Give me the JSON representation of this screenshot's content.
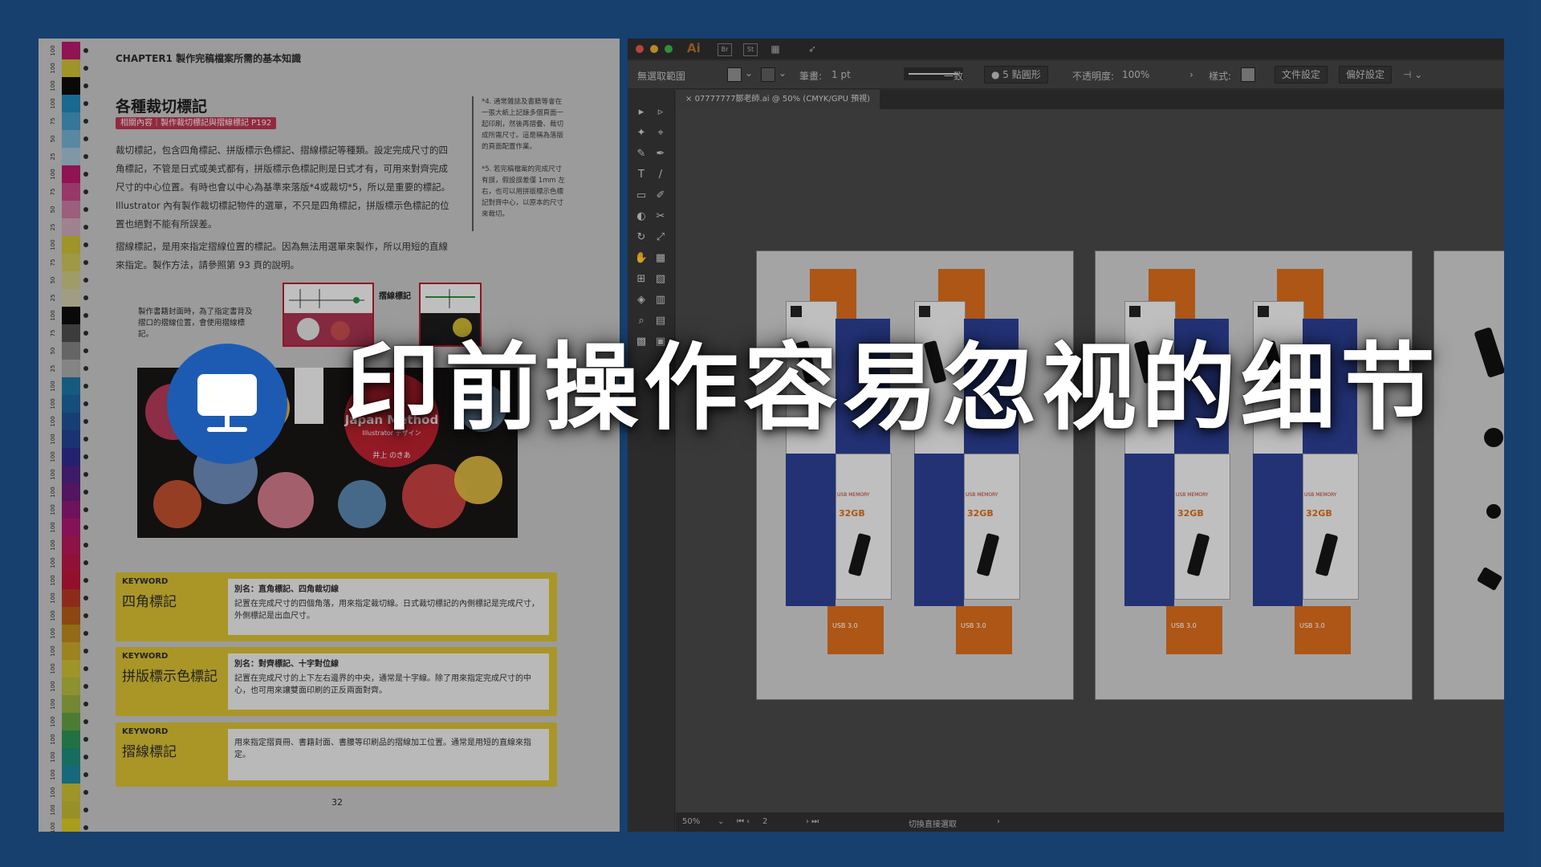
{
  "headline": "印前操作容易忽视的细节",
  "overlay_icon": "monitor-icon",
  "colors": {
    "background": "#1d4f87",
    "icon_circle": "#1d5bb3",
    "related_tag": "#b2334d",
    "keyword_box": "#cfb830",
    "crop_mark_box": "#b11a2c",
    "package_orange": "#d46a1c",
    "package_blue": "#2a3d8f"
  },
  "book": {
    "chapter": "CHAPTER1 製作完稿檔案所需的基本知識",
    "title": "各種裁切標記",
    "related": "相關內容｜製作裁切標記與摺線標記 P192",
    "para1": "裁切標記，包含四角標記、拼版標示色標記、摺線標記等種類。設定完成尺寸的四角標記，不管是日式或美式都有，拼版標示色標記則是日式才有，可用來對齊完成尺寸的中心位置。有時也會以中心為基準來落版*4或裁切*5，所以是重要的標記。Illustrator 內有製作裁切標記物件的選單，不只是四角標記，拼版標示色標記的位置也絕對不能有所誤差。",
    "para2": "摺線標記，是用來指定摺線位置的標記。因為無法用選單來製作，所以用短的直線來指定。製作方法，請參照第 93 頁的說明。",
    "note1": "*4. 通常雜誌及書籍等會在一張大紙上記錄多個頁面一起印刷，然後再摺疊、裁切成所需尺寸。這是稱為落版的頁面配置作業。",
    "note2": "*5. 若完稿檔案的完成尺寸有誤，假設誤差僅 1mm 左右，也可以用拼版標示色標記對齊中心，以原本的尺寸來裁切。",
    "caption": "製作書籍封面時，為了指定書背及摺口的摺線位置，會使用摺線標記。",
    "mark_label": "摺線標記",
    "cover_title": "Japan Method",
    "cover_sub": "Illustrator デザイン",
    "cover_author": "井上 のきあ",
    "keyword_label": "KEYWORD",
    "keywords": [
      {
        "term": "四角標記",
        "alias": "別名：直角標記、四角裁切線",
        "desc": "記置在完成尺寸的四個角落，用來指定裁切線。日式裁切標記的內側標記是完成尺寸，外側標記是出血尺寸。"
      },
      {
        "term": "拼版標示色標記",
        "alias": "別名：對齊標記、十字對位線",
        "desc": "記置在完成尺寸的上下左右邊界的中央，通常是十字線。除了用來指定完成尺寸的中心，也可用來讓雙面印刷的正反兩面對齊。"
      },
      {
        "term": "摺線標記",
        "alias": "",
        "desc": "用來指定摺頁冊、書籍封面、書腰等印刷品的摺線加工位置。通常是用短的直線來指定。"
      }
    ],
    "page_number": "32",
    "color_bar": [
      {
        "n": "100",
        "c": "#b01866"
      },
      {
        "n": "100",
        "c": "#c2b532"
      },
      {
        "n": "100",
        "c": "#0c0c0c"
      },
      {
        "n": "100",
        "c": "#1e7fb0"
      },
      {
        "n": "75",
        "c": "#4190bb"
      },
      {
        "n": "50",
        "c": "#6ea6c6"
      },
      {
        "n": "25",
        "c": "#9cb9cb"
      },
      {
        "n": "100",
        "c": "#b01866"
      },
      {
        "n": "75",
        "c": "#b9457f"
      },
      {
        "n": "50",
        "c": "#bf7398"
      },
      {
        "n": "25",
        "c": "#c29fb0"
      },
      {
        "n": "100",
        "c": "#c2b532"
      },
      {
        "n": "75",
        "c": "#c3ba56"
      },
      {
        "n": "50",
        "c": "#c4bf7e"
      },
      {
        "n": "25",
        "c": "#c3c0a2"
      },
      {
        "n": "100",
        "c": "#0c0c0c"
      },
      {
        "n": "75",
        "c": "#4a4a4a"
      },
      {
        "n": "50",
        "c": "#7c7c7c"
      },
      {
        "n": "25",
        "c": "#a2a2a2"
      },
      {
        "n": "100",
        "c": "#1a6f9a"
      },
      {
        "n": "100",
        "c": "#1a5e96"
      },
      {
        "n": "100",
        "c": "#1e4e8e"
      },
      {
        "n": "100",
        "c": "#223f89"
      },
      {
        "n": "100",
        "c": "#2c2a85"
      },
      {
        "n": "100",
        "c": "#4a217e"
      },
      {
        "n": "100",
        "c": "#651a76"
      },
      {
        "n": "100",
        "c": "#871870"
      },
      {
        "n": "100",
        "c": "#a3166a"
      },
      {
        "n": "100",
        "c": "#ad1656"
      },
      {
        "n": "100",
        "c": "#b01544"
      },
      {
        "n": "100",
        "c": "#b01532"
      },
      {
        "n": "100",
        "c": "#ad3522"
      },
      {
        "n": "100",
        "c": "#aa5618"
      },
      {
        "n": "100",
        "c": "#b3821e"
      },
      {
        "n": "100",
        "c": "#c09f2a"
      },
      {
        "n": "100",
        "c": "#c2b532"
      },
      {
        "n": "100",
        "c": "#aeb13a"
      },
      {
        "n": "100",
        "c": "#8ca63e"
      },
      {
        "n": "100",
        "c": "#5e9640"
      },
      {
        "n": "100",
        "c": "#2a8a52"
      },
      {
        "n": "100",
        "c": "#1b8675"
      },
      {
        "n": "100",
        "c": "#1b7f95"
      },
      {
        "n": "100",
        "c": "#c2b532"
      },
      {
        "n": "100",
        "c": "#b9b032"
      },
      {
        "n": "100",
        "c": "#d0c020"
      }
    ]
  },
  "illustrator": {
    "app_logo": "Ai",
    "menu_icons": [
      "Br",
      "St"
    ],
    "controls": {
      "no_selection": "無選取範圍",
      "stroke_label": "筆畫:",
      "stroke_value": "1 pt",
      "stroke_style": "一致",
      "brush": "5 點圓形",
      "opacity_label": "不透明度:",
      "opacity_value": "100%",
      "style_label": "樣式:",
      "doc_setup": "文件設定",
      "preferences": "偏好設定"
    },
    "doc_tab": "07777777鄒老師.ai @ 50% (CMYK/GPU 預視)",
    "status": {
      "zoom": "50%",
      "page": "2",
      "hint": "切換直接選取"
    },
    "package_texts": {
      "capacity": "32GB",
      "usb": "USB 3.0",
      "brand": "USB MEMORY"
    },
    "tools": [
      "▸",
      "▹",
      "✦",
      "⌖",
      "✎",
      "✒",
      "T",
      "/",
      "▭",
      "✐",
      "◐",
      "✂",
      "↻",
      "⤢",
      "✋",
      "▦",
      "⊞",
      "▧",
      "◈",
      "▥",
      "⌕",
      "▤",
      "▩",
      "▣"
    ]
  }
}
